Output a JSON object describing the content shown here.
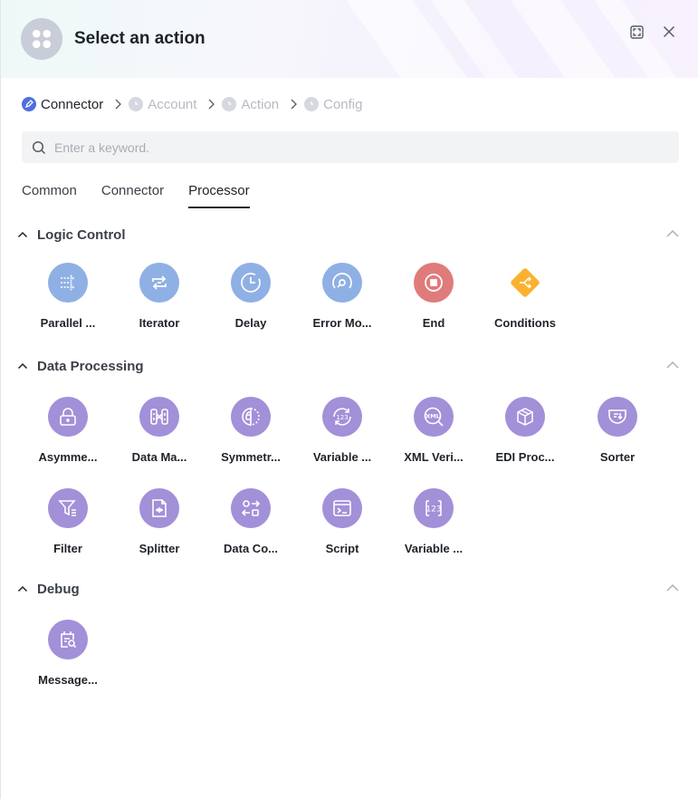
{
  "dialog": {
    "title": "Select an action",
    "icons": {
      "logo": "app-grid-icon",
      "expand": "fullscreen-icon",
      "close": "close-icon"
    }
  },
  "steps": [
    {
      "label": "Connector",
      "state": "active",
      "icon": "edit-icon"
    },
    {
      "label": "Account",
      "state": "inactive",
      "icon": "clock-icon"
    },
    {
      "label": "Action",
      "state": "inactive",
      "icon": "clock-icon"
    },
    {
      "label": "Config",
      "state": "inactive",
      "icon": "clock-icon"
    }
  ],
  "search": {
    "placeholder": "Enter a keyword.",
    "value": ""
  },
  "tabs": [
    {
      "label": "Common",
      "active": false
    },
    {
      "label": "Connector",
      "active": false
    },
    {
      "label": "Processor",
      "active": true
    }
  ],
  "sections": {
    "logic_control": {
      "title": "Logic Control",
      "items": [
        {
          "label": "Parallel ...",
          "icon": "parallel-icon"
        },
        {
          "label": "Iterator",
          "icon": "iterator-icon"
        },
        {
          "label": "Delay",
          "icon": "delay-icon"
        },
        {
          "label": "Error Mo...",
          "icon": "error-monitor-icon"
        },
        {
          "label": "End",
          "icon": "end-icon"
        },
        {
          "label": "Conditions",
          "icon": "conditions-icon"
        }
      ]
    },
    "data_processing": {
      "title": "Data Processing",
      "items": [
        {
          "label": "Asymme...",
          "icon": "asymmetric-encryption-icon"
        },
        {
          "label": "Data Ma...",
          "icon": "data-mapping-icon"
        },
        {
          "label": "Symmetr...",
          "icon": "symmetric-encryption-icon"
        },
        {
          "label": "Variable ...",
          "icon": "variable-cycle-icon"
        },
        {
          "label": "XML Veri...",
          "icon": "xml-verify-icon"
        },
        {
          "label": "EDI Proc...",
          "icon": "edi-processor-icon"
        },
        {
          "label": "Sorter",
          "icon": "sorter-icon"
        },
        {
          "label": "Filter",
          "icon": "filter-icon"
        },
        {
          "label": "Splitter",
          "icon": "splitter-icon"
        },
        {
          "label": "Data Co...",
          "icon": "data-conversion-icon"
        },
        {
          "label": "Script",
          "icon": "script-icon"
        },
        {
          "label": "Variable ...",
          "icon": "variable-icon"
        }
      ]
    },
    "debug": {
      "title": "Debug",
      "items": [
        {
          "label": "Message...",
          "icon": "message-inspect-icon"
        }
      ]
    }
  },
  "colors": {
    "blue_icon": "#8fb0e4",
    "red_icon": "#e07b7b",
    "orange_icon": "#fbb130",
    "purple_icon": "#a290d8",
    "active_step": "#4e6ee0"
  }
}
